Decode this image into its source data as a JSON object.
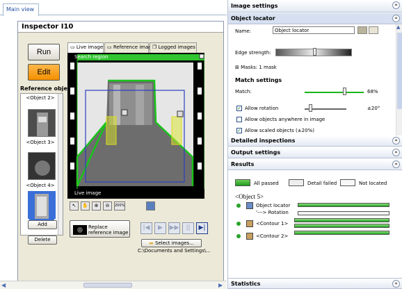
{
  "left": {
    "tab": "Main view",
    "inspector_title": "Inspector I10",
    "run_label": "Run",
    "edit_label": "Edit",
    "ref_header": "Reference object",
    "ref_items": [
      "<Object 2>",
      "<Object 3>",
      "<Object 4>"
    ],
    "add_label": "Add",
    "delete_label": "Delete",
    "image_tabs": [
      "Live image",
      "Reference image",
      "Logged images"
    ],
    "search_region": "Search region",
    "live_caption": "Live image",
    "zoom_label": "200%",
    "replace_label": "Replace reference image",
    "select_images_label": "Select images...",
    "path_text": "C:\\Documents and Settings\\..."
  },
  "right": {
    "image_settings": "Image settings",
    "object_locator": "Object locator",
    "name_label": "Name:",
    "name_value": "Object locator",
    "edge_strength": "Edge strength:",
    "edge_strength_level": 0.5,
    "masks": "Masks: 1 mask",
    "match_settings": "Match settings",
    "match_label": "Match:",
    "match_value": "68%",
    "match_level": 0.68,
    "allow_rotation": "Allow rotation",
    "rotation_value": "±20°",
    "allow_anywhere": "Allow objects anywhere in image",
    "allow_scaled": "Allow scaled objects (±20%)",
    "detailed_inspections": "Detailed inspections",
    "output_settings": "Output settings",
    "results": "Results",
    "legend_passed": "All passed",
    "legend_failed": "Detail failed",
    "legend_notlocated": "Not located",
    "result_title": "<Object 5>",
    "result_rows": [
      "Object locator",
      "'---> Rotation",
      "<Contour 1>",
      "<Contour 2>"
    ],
    "statistics": "Statistics"
  }
}
